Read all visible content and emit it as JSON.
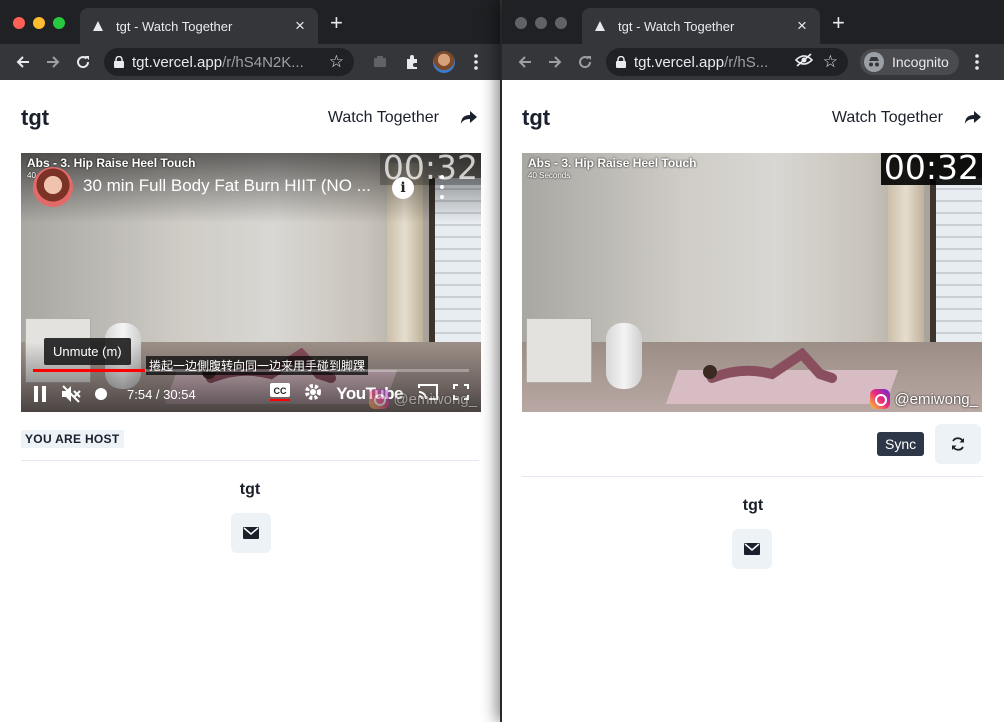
{
  "browser": {
    "tab_title": "tgt - Watch Together",
    "url_host": "tgt.vercel.app",
    "url_path_left": "/r/hS4N2K...",
    "url_path_right": "/r/hS...",
    "incognito_label": "Incognito"
  },
  "app": {
    "brand": "tgt",
    "header_link": "Watch Together",
    "host_badge": "YOU ARE HOST",
    "footer_title": "tgt"
  },
  "video": {
    "exercise_title": "Abs - 3. Hip Raise Heel Touch",
    "exercise_duration": "40 Seconds",
    "left_duration_partial": "40",
    "timer": "00:32",
    "watermark": "@emiwong_",
    "yt_title": "30 min Full Body Fat Burn HIIT (NO ...",
    "yt_info": "i",
    "tooltip": "Unmute (m)",
    "caption": "捲起一边側腹转向同一边来用手碰到脚踝",
    "time_display": "7:54 / 30:54",
    "yt_logo": "YouTube",
    "progress": 0.256
  },
  "sync": {
    "label": "Sync"
  },
  "colors": {
    "close": "#ff5f57",
    "minimize": "#febc2e",
    "maximize": "#28c840",
    "inactive_light": "#5f6368",
    "yt_red": "#ff0000"
  }
}
